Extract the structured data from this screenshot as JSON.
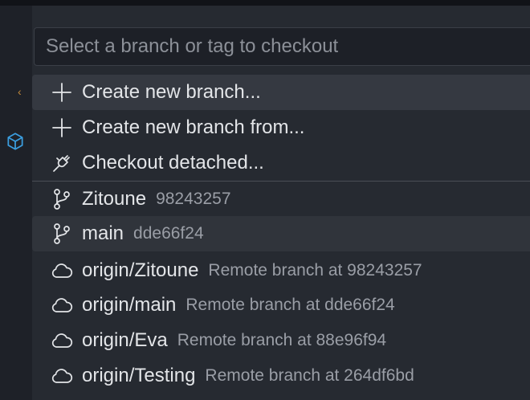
{
  "search": {
    "placeholder": "Select a branch or tag to checkout"
  },
  "actions": [
    {
      "icon": "plus-icon",
      "label": "Create new branch..."
    },
    {
      "icon": "plus-icon",
      "label": "Create new branch from..."
    },
    {
      "icon": "plug-icon",
      "label": "Checkout detached..."
    }
  ],
  "local_branches": [
    {
      "icon": "git-branch-icon",
      "label": "Zitoune",
      "desc": "98243257"
    },
    {
      "icon": "git-branch-icon",
      "label": "main",
      "desc": "dde66f24"
    }
  ],
  "remote_branches": [
    {
      "icon": "cloud-icon",
      "label": "origin/Zitoune",
      "desc": "Remote branch at 98243257"
    },
    {
      "icon": "cloud-icon",
      "label": "origin/main",
      "desc": "Remote branch at dde66f24"
    },
    {
      "icon": "cloud-icon",
      "label": "origin/Eva",
      "desc": "Remote branch at 88e96f94"
    },
    {
      "icon": "cloud-icon",
      "label": "origin/Testing",
      "desc": "Remote branch at 264df6bd"
    }
  ],
  "colors": {
    "background": "#262a31",
    "highlight": "#353941",
    "text": "#e3e5e8",
    "description": "#9a9ea6",
    "side_icon": "#3b9ee0"
  }
}
